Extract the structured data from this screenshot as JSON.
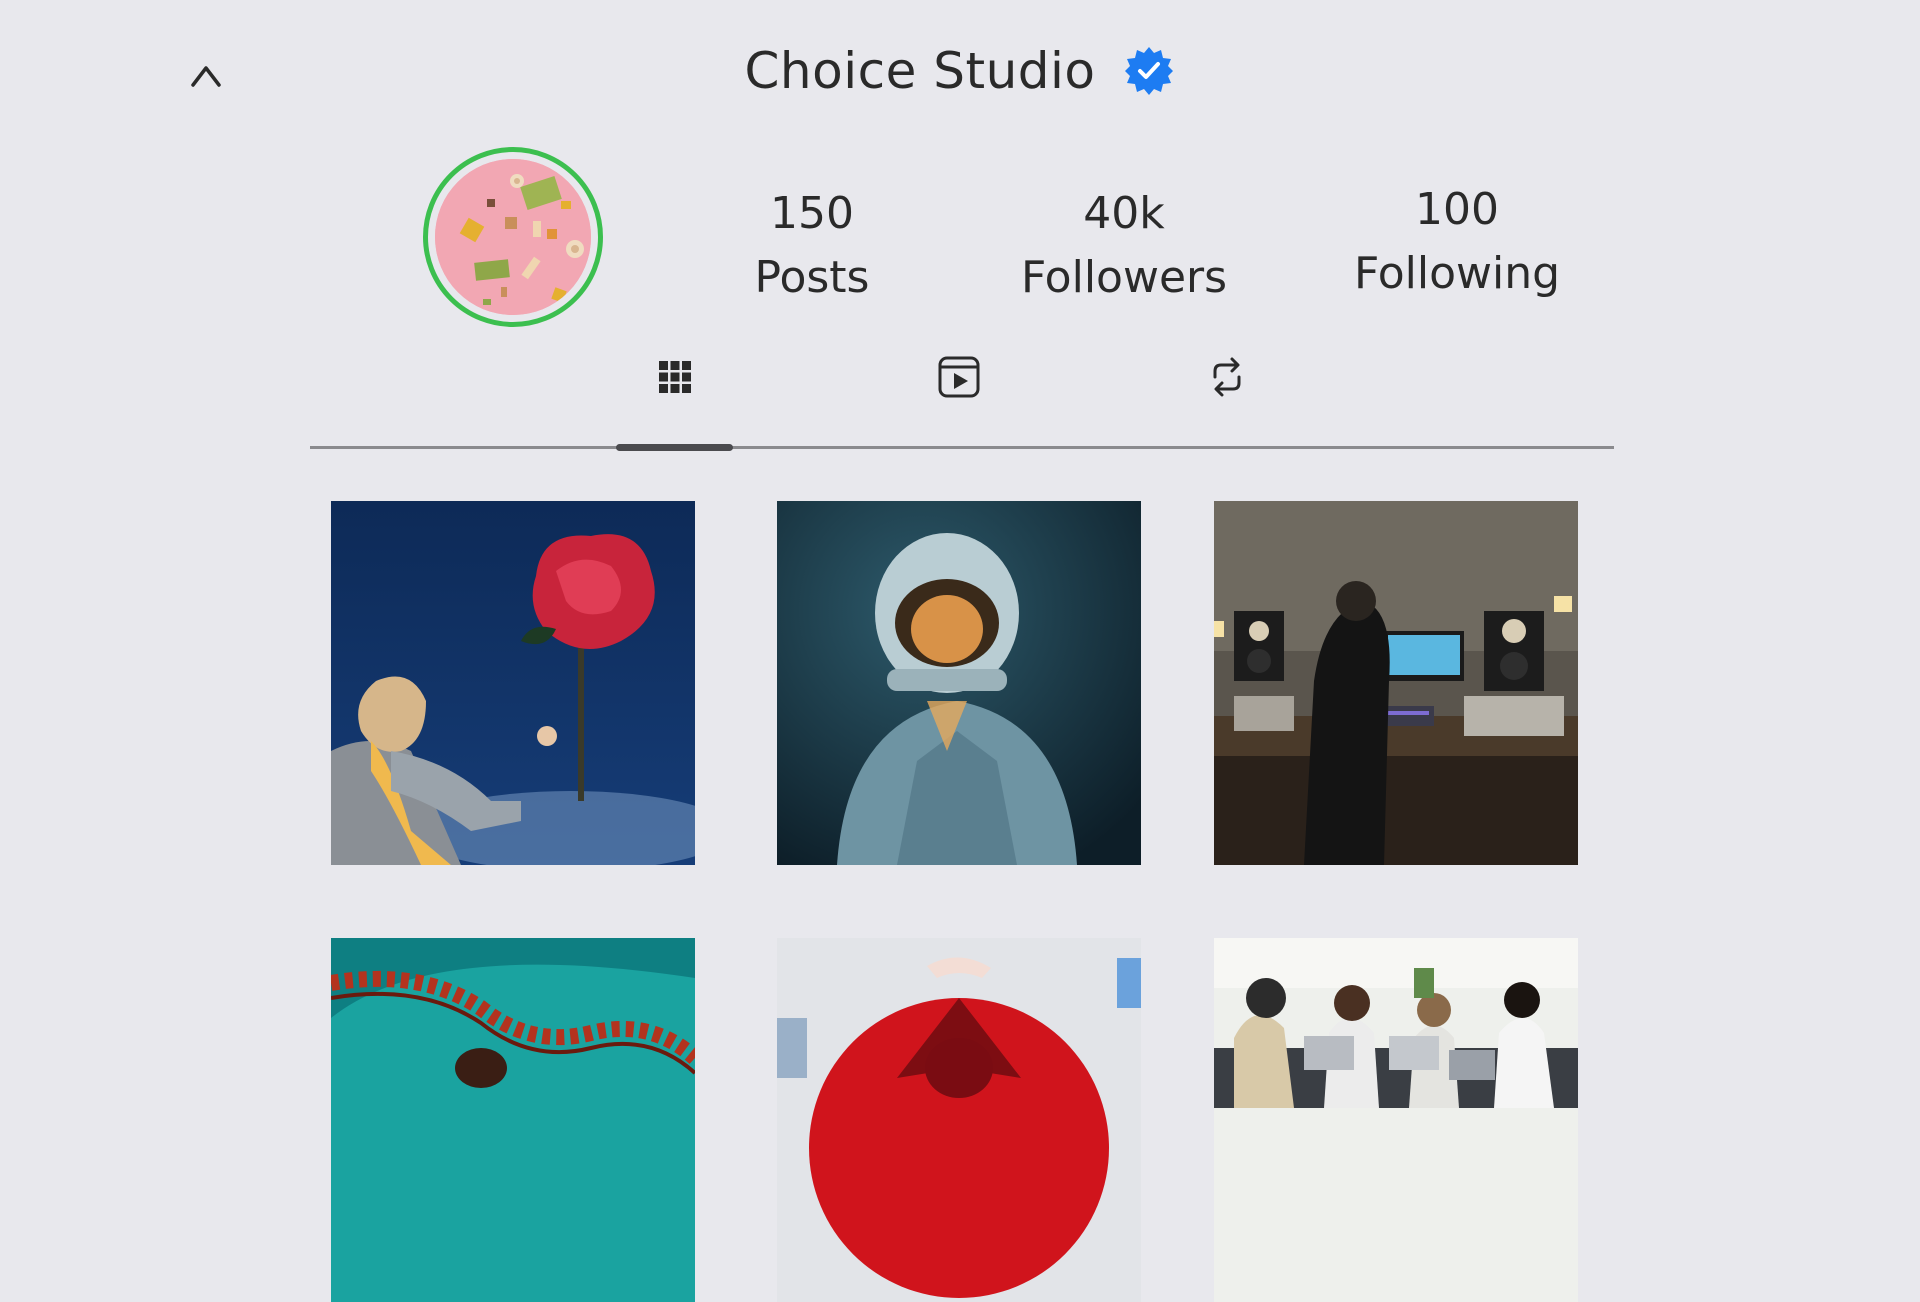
{
  "header": {
    "title": "Choice Studio",
    "verified": true
  },
  "colors": {
    "background": "#e8e8ed",
    "story_ring": "#3cbf4f",
    "verified_badge": "#1d7cf2",
    "text": "#2a2a2a"
  },
  "stats": [
    {
      "value": "150",
      "label": "Posts"
    },
    {
      "value": "40k",
      "label": "Followers"
    },
    {
      "value": "100",
      "label": "Following"
    }
  ],
  "tabs": [
    {
      "icon": "grid-icon",
      "selected": true
    },
    {
      "icon": "reels-icon",
      "selected": false
    },
    {
      "icon": "repost-icon",
      "selected": false
    }
  ],
  "posts": [
    {
      "name": "post-rose-girl"
    },
    {
      "name": "post-astronaut"
    },
    {
      "name": "post-studio-producer"
    },
    {
      "name": "post-pool-swimmer"
    },
    {
      "name": "post-red-umbrella"
    },
    {
      "name": "post-team-meeting"
    }
  ]
}
